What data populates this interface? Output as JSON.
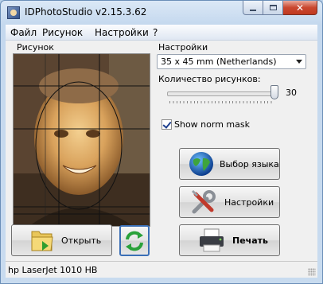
{
  "window": {
    "title": "IDPhotoStudio v2.15.3.62"
  },
  "menu": [
    "Файл",
    "Рисунок",
    "Настройки",
    "?"
  ],
  "photo_group": {
    "label": "Рисунок"
  },
  "settings_group": {
    "label": "Настройки",
    "format_selected": "35 x 45 mm (Netherlands)",
    "count_label": "Количество рисунков:",
    "count_value": "30",
    "count_fraction": 1.0,
    "show_norm_mask_label": "Show norm mask",
    "show_norm_mask_checked": true
  },
  "buttons": {
    "language": "Выбор языка",
    "settings": "Настройки",
    "open": "Открыть",
    "print": "Печать"
  },
  "status": {
    "printer": "hp LaserJet 1010 HB"
  },
  "icons": {
    "app": "app-icon",
    "globe": "globe-icon",
    "tools": "tools-icon",
    "folder": "folder-icon",
    "rotate": "rotate-icon",
    "printer": "printer-icon"
  },
  "colors": {
    "title_bg": "#c4d8ee",
    "accent": "#1d3f8f",
    "close": "#c9472f"
  }
}
